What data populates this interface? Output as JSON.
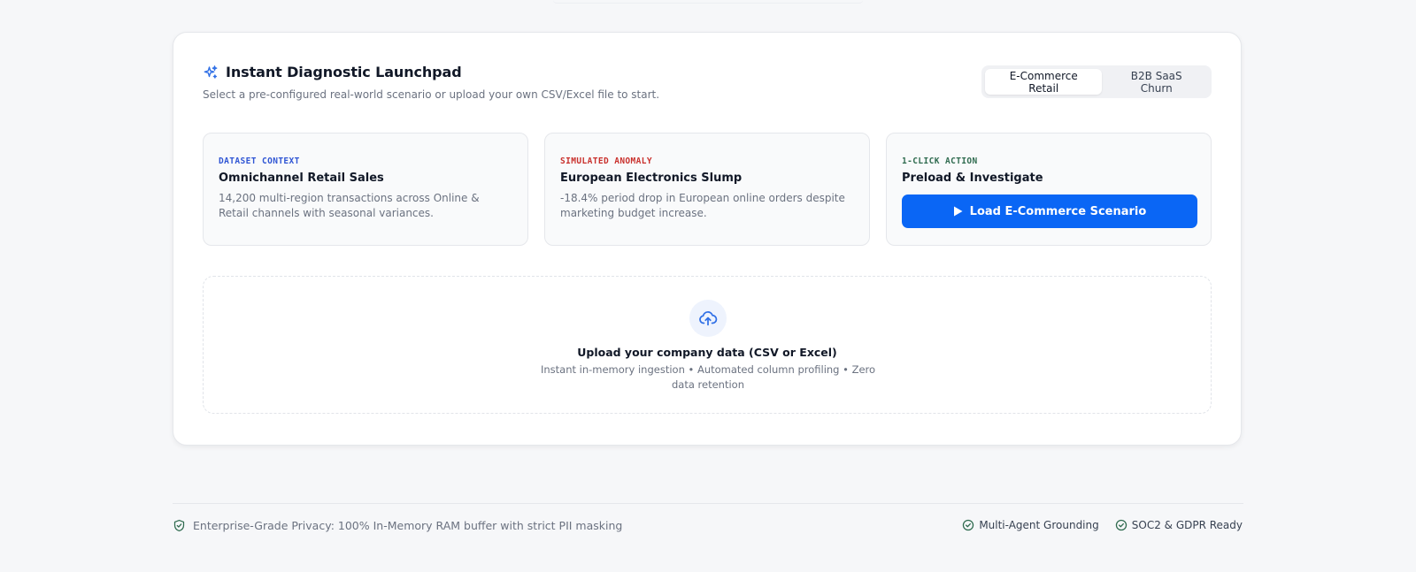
{
  "header": {
    "title": "Instant Diagnostic Launchpad",
    "subtitle": "Select a pre-configured real-world scenario or upload your own CSV/Excel file to start."
  },
  "scenario_tabs": [
    {
      "label": "E-Commerce Retail",
      "active": true
    },
    {
      "label": "B2B SaaS Churn",
      "active": false
    }
  ],
  "tiles": {
    "context": {
      "kicker": "DATASET CONTEXT",
      "title": "Omnichannel Retail Sales",
      "desc": "14,200 multi-region transactions across Online & Retail channels with seasonal variances."
    },
    "anomaly": {
      "kicker": "SIMULATED ANOMALY",
      "title": "European Electronics Slump",
      "desc": "-18.4% period drop in European online orders despite marketing budget increase."
    },
    "action": {
      "kicker": "1-CLICK ACTION",
      "title": "Preload & Investigate",
      "button_label": "Load E-Commerce Scenario"
    }
  },
  "upload": {
    "title": "Upload your company data (CSV or Excel)",
    "subtitle": "Instant in-memory ingestion • Automated column profiling • Zero data retention"
  },
  "footer": {
    "privacy": "Enterprise-Grade Privacy: 100% In-Memory RAM buffer with strict PII masking",
    "badges": [
      "Multi-Agent Grounding",
      "SOC2 & GDPR Ready"
    ]
  },
  "colors": {
    "accent": "#0a66f5",
    "context_kicker": "#2f55d4",
    "anomaly_kicker": "#c9302c",
    "action_kicker": "#2f6b4f",
    "success": "#2f6b4f"
  },
  "icons": {
    "header": "sparkles-icon",
    "play": "play-icon",
    "upload": "cloud-upload-icon",
    "privacy": "shield-check-icon",
    "badge": "check-circle-icon"
  }
}
